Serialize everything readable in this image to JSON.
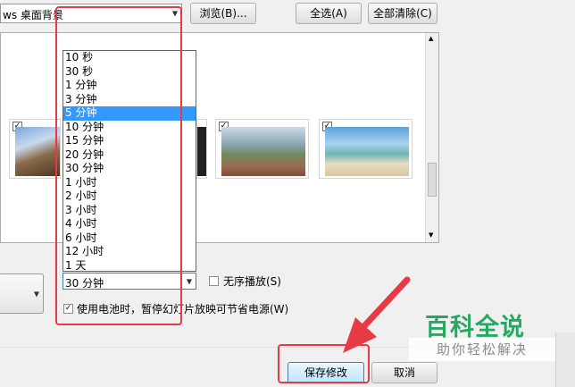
{
  "header": {
    "location_value": "ws 桌面背景",
    "browse_label": "浏览(B)...",
    "select_all_label": "全选(A)",
    "clear_all_label": "全部清除(C)"
  },
  "interval": {
    "options": [
      "10 秒",
      "30 秒",
      "1 分钟",
      "3 分钟",
      "5 分钟",
      "10 分钟",
      "15 分钟",
      "20 分钟",
      "30 分钟",
      "1 小时",
      "2 小时",
      "3 小时",
      "4 小时",
      "6 小时",
      "12 小时",
      "1 天"
    ],
    "highlighted": "5 分钟",
    "current_value": "30 分钟"
  },
  "shuffle_label": "无序播放(S)",
  "battery_label": "使用电池时，暂停幻灯片放映可节省电源(W)",
  "footer": {
    "save_label": "保存修改",
    "cancel_label": "取消"
  },
  "watermark": {
    "title": "百科全说",
    "subtitle": "助你轻松解决"
  },
  "colors": {
    "highlight": "#3399ff",
    "annotation_red": "#e63b44",
    "watermark_green": "#27a862"
  }
}
